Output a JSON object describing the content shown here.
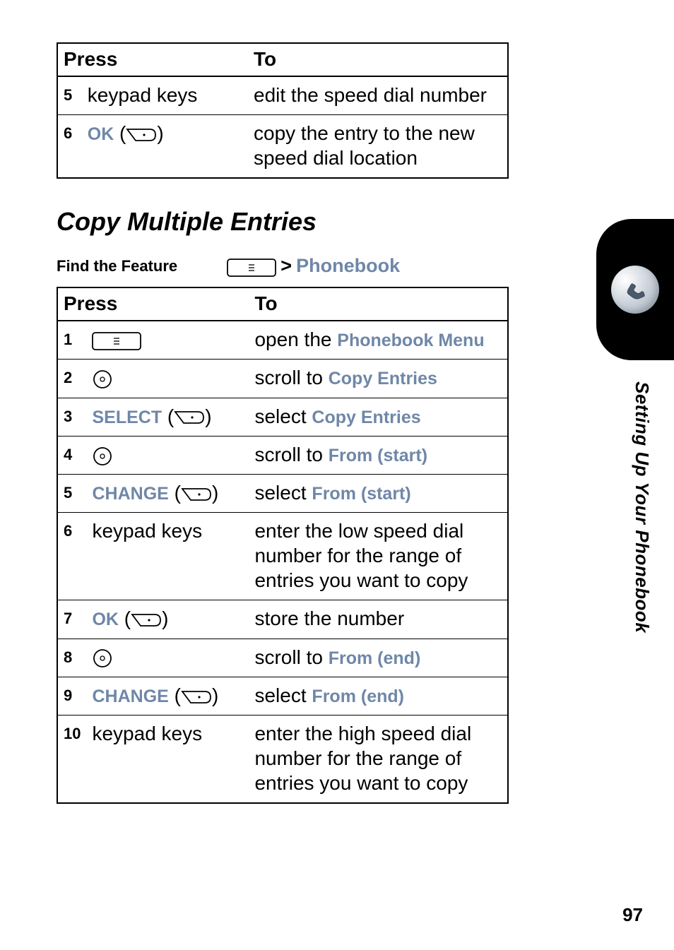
{
  "top_table": {
    "head_press": "Press",
    "head_to": "To",
    "rows": [
      {
        "n": "5",
        "key": "keypad keys",
        "to": "edit the speed dial number"
      },
      {
        "n": "6",
        "key_soft": "OK",
        "to": "copy the entry to the new speed dial location"
      }
    ]
  },
  "heading": "Copy Multiple Entries",
  "find": {
    "label": "Find the Feature",
    "chevron": ">",
    "target": "Phonebook"
  },
  "main_table": {
    "head_press": "Press",
    "head_to": "To",
    "rows": [
      {
        "n": "1",
        "icon": "menu-rect",
        "to_before": "open the ",
        "to_soft": "Phonebook Menu"
      },
      {
        "n": "2",
        "icon": "nav-circle",
        "to_before": "scroll to ",
        "to_soft": "Copy Entries"
      },
      {
        "n": "3",
        "key_soft": "SELECT",
        "to_before": "select ",
        "to_soft": "Copy Entries"
      },
      {
        "n": "4",
        "icon": "nav-circle",
        "to_before": "scroll to ",
        "to_soft": "From (start)"
      },
      {
        "n": "5",
        "key_soft": "CHANGE",
        "to_before": "select ",
        "to_soft": "From (start)"
      },
      {
        "n": "6",
        "key": "keypad keys",
        "to_plain": "enter the low speed dial number for the range of entries you want to copy"
      },
      {
        "n": "7",
        "key_soft": "OK",
        "to_plain": "store the number"
      },
      {
        "n": "8",
        "icon": "nav-circle",
        "to_before": "scroll to ",
        "to_soft": "From (end)"
      },
      {
        "n": "9",
        "key_soft": "CHANGE",
        "to_before": "select ",
        "to_soft": "From (end)"
      },
      {
        "n": "10",
        "key": "keypad keys",
        "to_plain": "enter the high speed dial number for the range of entries you want to copy"
      }
    ]
  },
  "side_text": "Setting Up Your Phonebook",
  "page_number": "97"
}
